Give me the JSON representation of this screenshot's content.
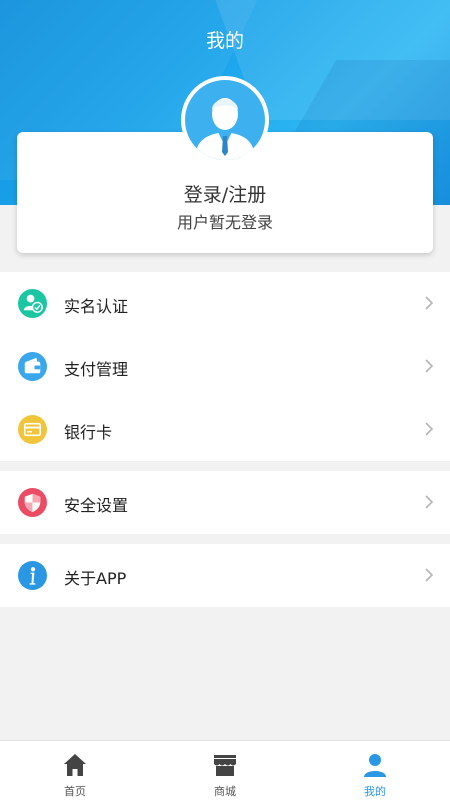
{
  "header": {
    "title": "我的"
  },
  "profile": {
    "login_label": "登录/注册",
    "status": "用户暂无登录"
  },
  "menu": {
    "group1": [
      {
        "label": "实名认证",
        "icon": "verified-user-icon",
        "color": "#1bc6a3"
      },
      {
        "label": "支付管理",
        "icon": "wallet-icon",
        "color": "#3aa7ec"
      },
      {
        "label": "银行卡",
        "icon": "bank-card-icon",
        "color": "#f0c53a"
      }
    ],
    "group2": [
      {
        "label": "安全设置",
        "icon": "shield-icon",
        "color": "#ec4b64"
      }
    ],
    "group3": [
      {
        "label": "关于APP",
        "icon": "info-icon",
        "color": "#2a97e4"
      }
    ]
  },
  "tabbar": {
    "items": [
      {
        "label": "首页",
        "icon": "home-icon"
      },
      {
        "label": "商城",
        "icon": "store-icon"
      },
      {
        "label": "我的",
        "icon": "user-icon",
        "active": true
      }
    ]
  },
  "colors": {
    "accent": "#2a97e4",
    "header": "#1aa3ea"
  }
}
